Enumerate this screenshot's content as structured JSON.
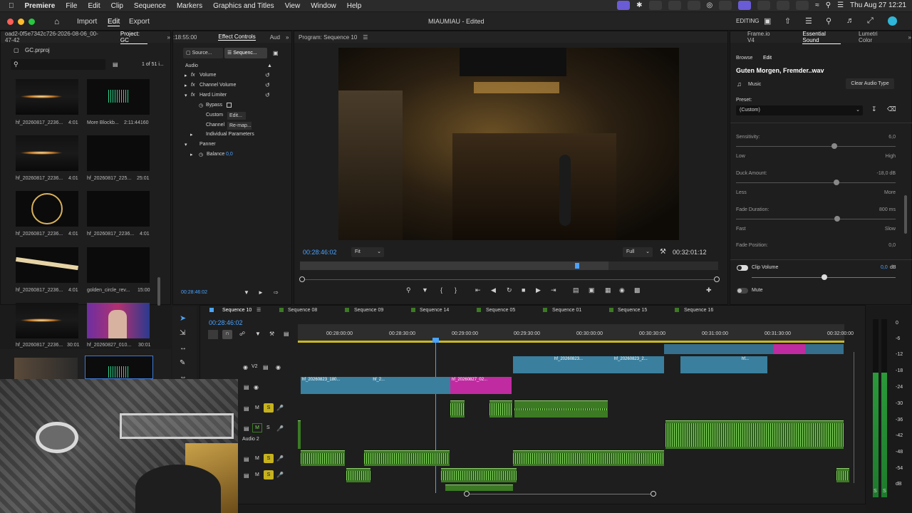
{
  "menubar": {
    "app": "Premiere",
    "items": [
      "File",
      "Edit",
      "Clip",
      "Sequence",
      "Markers",
      "Graphics and Titles",
      "View",
      "Window",
      "Help"
    ],
    "clock": "Thu Aug 27  12:21"
  },
  "apptop": {
    "import": "Import",
    "edit": "Edit",
    "export": "Export",
    "title": "MIAUMIAU - Edited",
    "workspace": "EDITING"
  },
  "project": {
    "tab_path": "oad2-0f5e7342c726-2026-08-06_00-47-42",
    "tab_project": "Project: GC",
    "file": "GC.prproj",
    "count": "1 of 51 i...",
    "items": [
      {
        "name": "hf_20260817_2236...",
        "dur": "4:01"
      },
      {
        "name": "More Blockb...",
        "dur": "2:11:44160"
      },
      {
        "name": "hf_20260817_2236...",
        "dur": "4:01"
      },
      {
        "name": "hf_20260817_225...",
        "dur": "25:01"
      },
      {
        "name": "hf_20260817_2236...",
        "dur": "4:01"
      },
      {
        "name": "hf_20260817_2236...",
        "dur": "4:01"
      },
      {
        "name": "hf_20260817_2236...",
        "dur": "4:01"
      },
      {
        "name": "golden_circle_rev...",
        "dur": "15:00"
      },
      {
        "name": "hf_20260817_2236...",
        "dur": "30:01"
      },
      {
        "name": "hf_20260827_010...",
        "dur": "30:01"
      }
    ]
  },
  "effects": {
    "tc_top": ":18:55:00",
    "tab": "Effect Controls",
    "tab2": "Aud",
    "source": "Source...",
    "sequence": "Sequenc...",
    "audio": "Audio",
    "rows": [
      "Volume",
      "Channel Volume",
      "Hard Limiter",
      "Bypass",
      "Custom",
      "Channel",
      "Individual Parameters",
      "Panner",
      "Balance"
    ],
    "custom_btn": "Edit...",
    "channel_btn": "Re-map...",
    "balance_val": "0,0",
    "tc_bottom": "00:28:46:02"
  },
  "program": {
    "title": "Program: Sequence 10",
    "tc": "00:28:46:02",
    "fit": "Fit",
    "full": "Full",
    "duration": "00:32:01:12"
  },
  "essential": {
    "tabs": [
      "Frame.io V4",
      "Essential Sound",
      "Lumetri Color"
    ],
    "browse": "Browse",
    "edit": "Edit",
    "file": "Guten Morgen, Fremder..wav",
    "type": "Music",
    "clear": "Clear Audio Type",
    "preset_label": "Preset:",
    "preset": "(Custom)",
    "sensitivity": "Sensitivity:",
    "sens_val": "6,0",
    "low": "Low",
    "high": "High",
    "duck": "Duck Amount:",
    "duck_val": "-18,0 dB",
    "less": "Less",
    "more": "More",
    "fade_dur": "Fade Duration:",
    "fade_dur_val": "800 ms",
    "fast": "Fast",
    "slow": "Slow",
    "fade_pos": "Fade Position:",
    "fade_pos_val": "0,0",
    "clip_volume": "Clip Volume",
    "clip_volume_val": "0,0",
    "db": "dB",
    "mute": "Mute"
  },
  "timeline": {
    "tabs": [
      "Sequence 10",
      "Sequence 08",
      "Sequence 09",
      "Sequence 14",
      "Sequence 05",
      "Sequence 01",
      "Sequence 15",
      "Sequence 16"
    ],
    "tc": "00:28:46:02",
    "ruler": [
      "00:28:00:00",
      "00:28:30:00",
      "00:29:00:00",
      "00:29:30:00",
      "00:30:00:00",
      "00:30:30:00",
      "00:31:00:00",
      "00:31:30:00",
      "00:32:00:00"
    ],
    "v2": "V2",
    "audio2": "Audio 2",
    "clips": [
      {
        "label": "hf_20260823_180...",
        "color": "vclip"
      },
      {
        "label": "hf_2...",
        "color": "vclip"
      },
      {
        "label": "hf_20260827_02...",
        "color": "pclip"
      },
      {
        "label": "hf_20260823...",
        "color": "vclip"
      },
      {
        "label": "hf_20260823_2...",
        "color": "vclip"
      },
      {
        "label": "hf...",
        "color": "vclip"
      }
    ]
  },
  "meter": {
    "scale": [
      "0",
      "-6",
      "-12",
      "-18",
      "-24",
      "-30",
      "-36",
      "-42",
      "-48",
      "-54",
      "dB"
    ],
    "s": "S"
  }
}
